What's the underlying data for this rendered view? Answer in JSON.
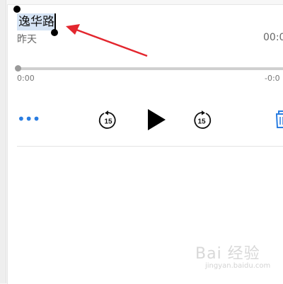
{
  "recording": {
    "title": "逸华路",
    "date": "昨天",
    "duration": "00:0",
    "time_start": "0:00",
    "time_end": "-0:0"
  },
  "controls": {
    "more_label": "•••",
    "skip_back_number": "15",
    "skip_forward_number": "15"
  },
  "watermark": {
    "brand": "Bai 经验",
    "url": "jingyan.baidu.com"
  },
  "colors": {
    "accent": "#2a7de1",
    "annotation_arrow": "#e3262e",
    "selection": "#d6e4f5"
  }
}
